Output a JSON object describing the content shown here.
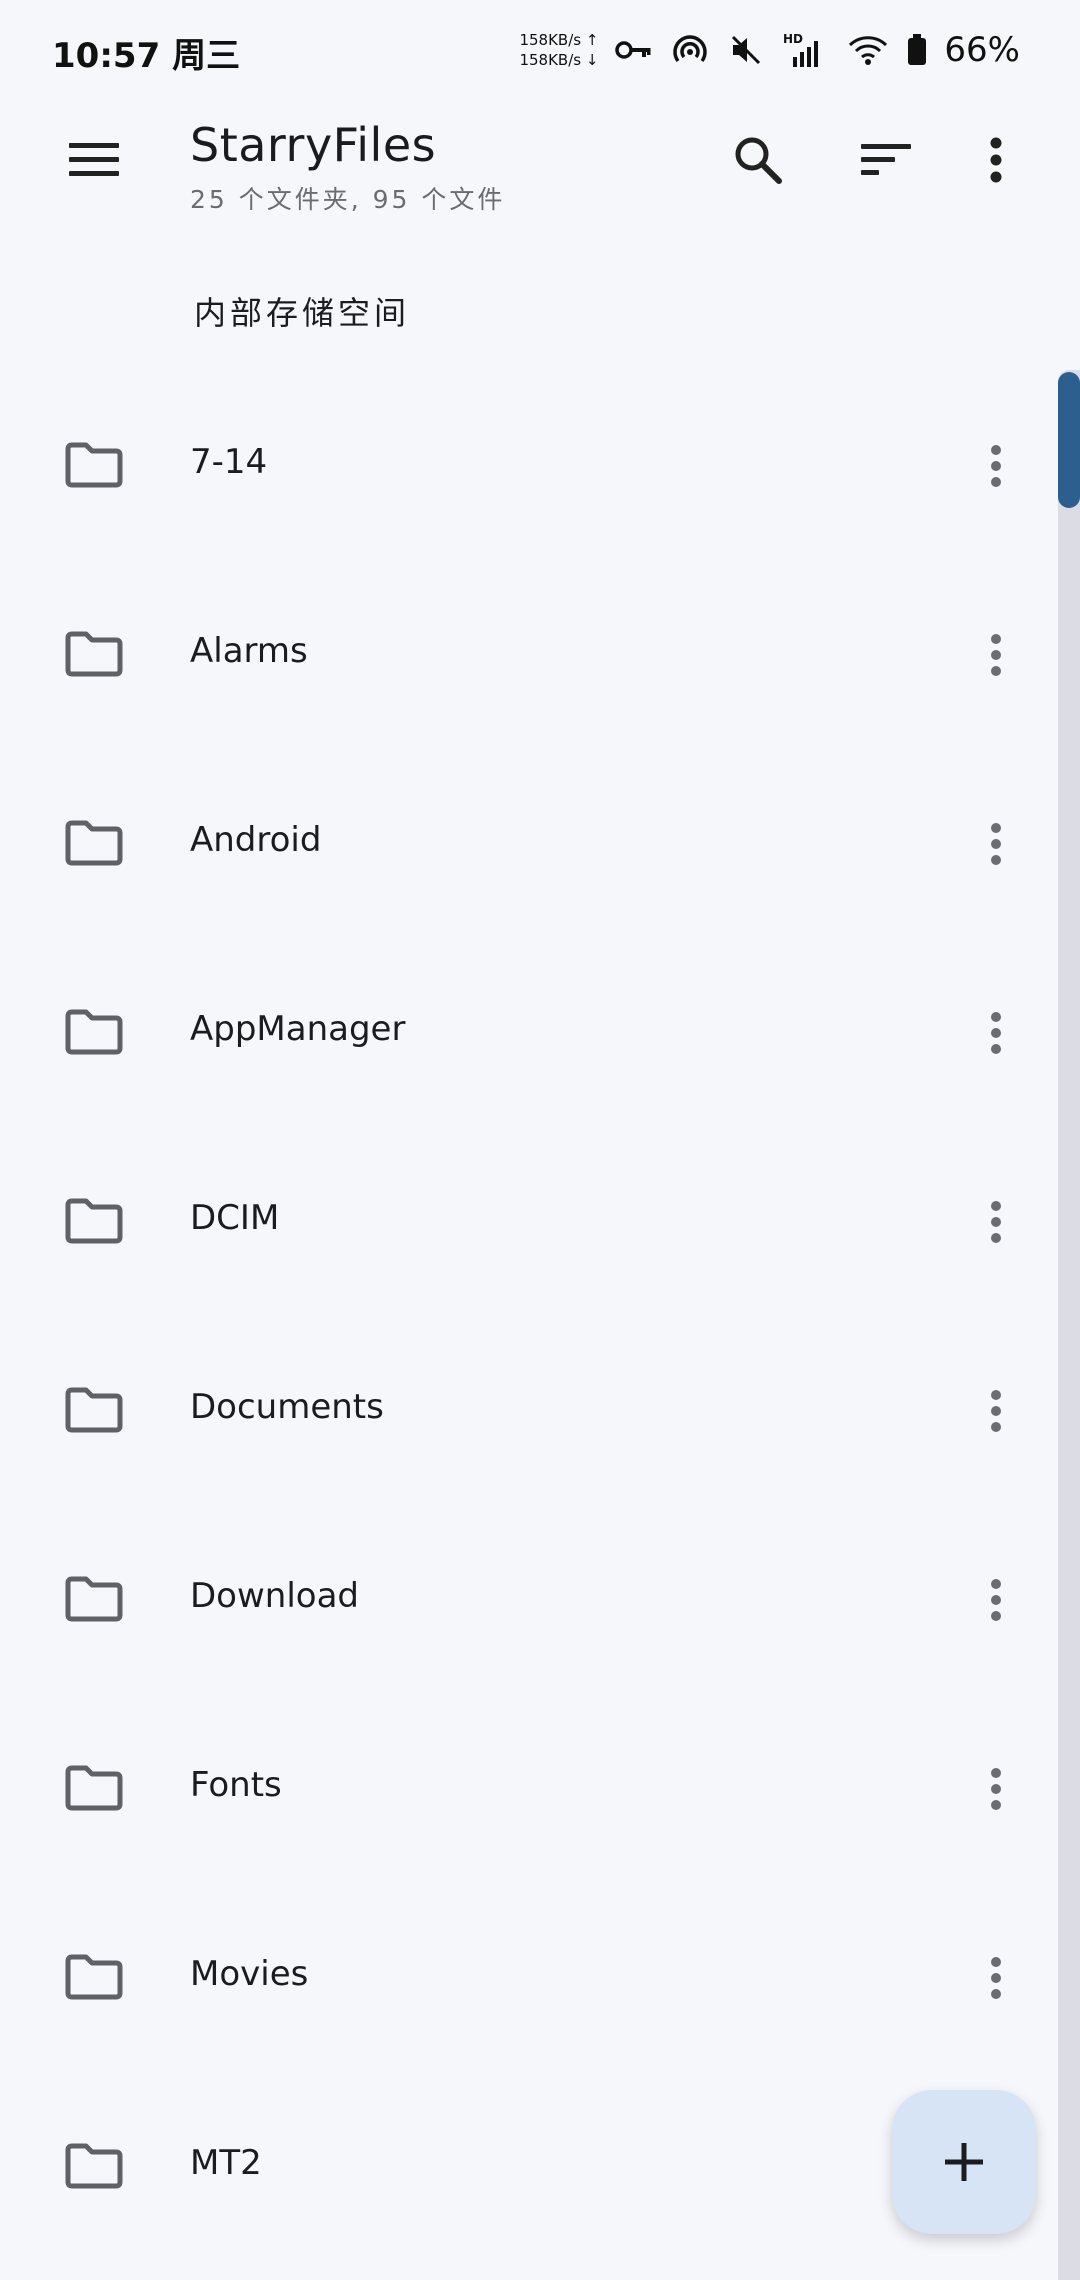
{
  "status_bar": {
    "time": "10:57",
    "weekday": "周三",
    "upload_speed": "158KB/s ↑",
    "download_speed": "158KB/s ↓",
    "network_label": "HD",
    "battery": "66%"
  },
  "appbar": {
    "title": "StarryFiles",
    "subtitle": "25 个文件夹, 95 个文件",
    "menu_icon": "menu-icon",
    "search_icon": "search-icon",
    "sort_icon": "sort-icon",
    "more_icon": "more-vert-icon"
  },
  "breadcrumb": "内部存储空间",
  "folders": [
    {
      "name": "7-14"
    },
    {
      "name": "Alarms"
    },
    {
      "name": "Android"
    },
    {
      "name": "AppManager"
    },
    {
      "name": "DCIM"
    },
    {
      "name": "Documents"
    },
    {
      "name": "Download"
    },
    {
      "name": "Fonts"
    },
    {
      "name": "Movies"
    },
    {
      "name": "MT2"
    }
  ],
  "fab": {
    "icon": "add-icon"
  },
  "colors": {
    "background": "#f6f7fb",
    "scroll_thumb": "#2d5f8e",
    "fab": "#d6e4f6",
    "folder_icon": "#5f6166"
  }
}
